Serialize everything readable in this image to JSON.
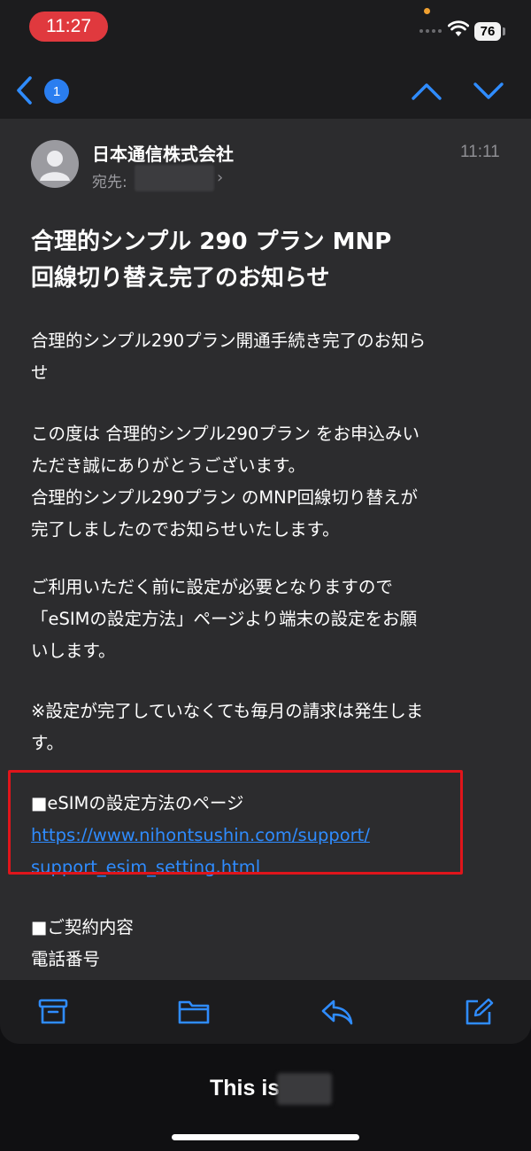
{
  "status_bar": {
    "time": "11:27",
    "battery": "76"
  },
  "nav": {
    "unread_count": "1"
  },
  "mail": {
    "sender": "日本通信株式会社",
    "to_label": "宛先:",
    "time": "11:11",
    "subject_lines": [
      "合理的シンプル 290 プラン MNP",
      "回線切り替え完了のお知らせ"
    ],
    "body": {
      "p1": [
        "合理的シンプル290プラン開通手続き完了のお知ら",
        "せ"
      ],
      "p2": [
        "この度は 合理的シンプル290プラン をお申込みい",
        "ただき誠にありがとうございます。",
        "合理的シンプル290プラン のMNP回線切り替えが",
        "完了しましたのでお知らせいたします。"
      ],
      "p3": [
        "ご利用いただく前に設定が必要となりますので",
        "「eSIMの設定方法」ページより端末の設定をお願",
        "いします。"
      ],
      "p4": [
        "※設定が完了していなくても毎月の請求は発生しま",
        "す。"
      ],
      "esim_heading": "■eSIMの設定方法のページ",
      "esim_link_lines": [
        "https://www.nihontsushin.com/support/",
        "support_esim_setting.html"
      ],
      "contract_heading": "■ご契約内容",
      "phone_label": "電話番号"
    }
  },
  "toolbar": {
    "icons": [
      "archive-icon",
      "folder-icon",
      "reply-icon",
      "compose-icon"
    ]
  },
  "banner": {
    "text": "This is"
  },
  "colors": {
    "accent": "#2f8cff",
    "highlight_border": "#e0151b",
    "time_pill": "#e0393e",
    "mail_background": "#2c2c2e"
  }
}
